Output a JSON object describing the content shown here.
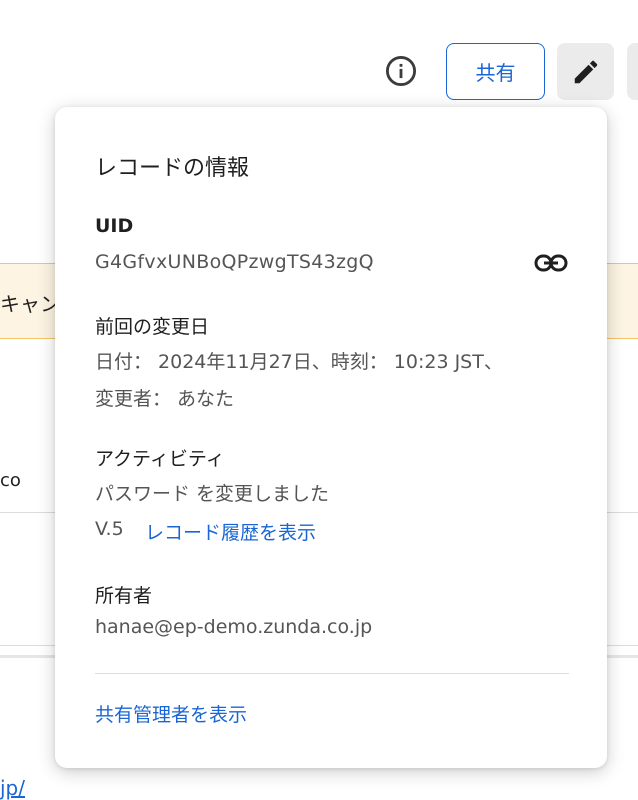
{
  "background": {
    "banner_text": "キャン",
    "co_text": "co",
    "link_text": "jp/"
  },
  "toolbar": {
    "info_icon": "info-icon",
    "share_label": "共有",
    "edit_icon": "pencil-icon"
  },
  "record_info": {
    "title": "レコードの情報",
    "uid_label": "UID",
    "uid_value": "G4GfvxUNBoQPzwgTS43zgQ",
    "copy_icon": "link-icon",
    "last_modified_label": "前回の変更日",
    "last_modified_line1": "日付： 2024年11月27日、時刻： 10:23 JST、",
    "last_modified_line2": "変更者： あなた",
    "activity_label": "アクティビティ",
    "activity_value": "パスワード を変更しました",
    "version": "V.5",
    "history_link": "レコード履歴を表示",
    "owner_label": "所有者",
    "owner_value": "hanae@ep-demo.zunda.co.jp",
    "admins_link": "共有管理者を表示"
  },
  "colors": {
    "accent": "#1a66d6",
    "banner_bg": "#fdf4e3",
    "banner_border": "#f2c46b"
  }
}
